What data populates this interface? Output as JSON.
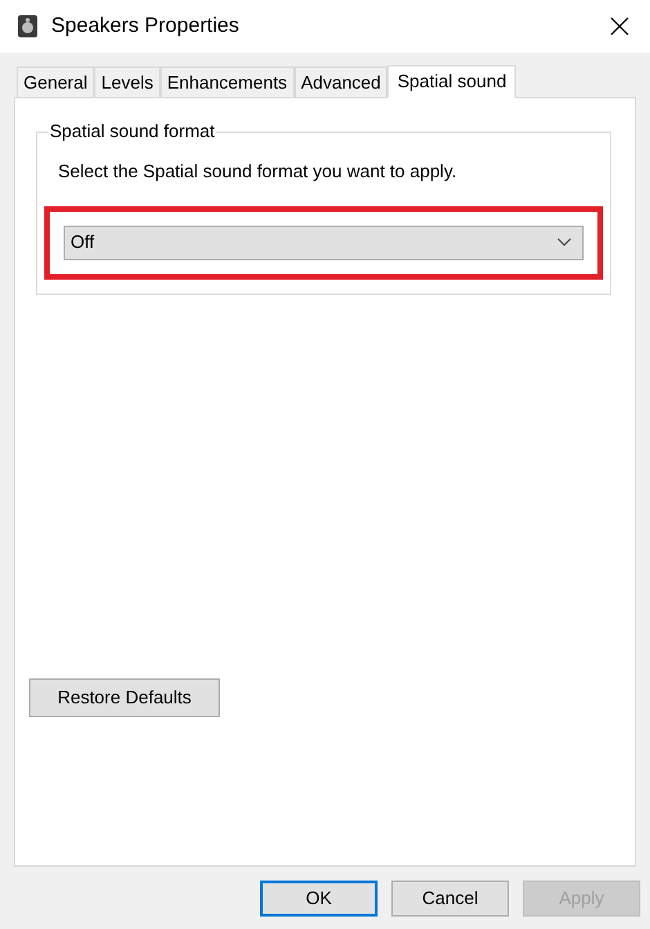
{
  "window": {
    "title": "Speakers Properties"
  },
  "tabs": [
    {
      "label": "General",
      "selected": false
    },
    {
      "label": "Levels",
      "selected": false
    },
    {
      "label": "Enhancements",
      "selected": false
    },
    {
      "label": "Advanced",
      "selected": false
    },
    {
      "label": "Spatial sound",
      "selected": true
    }
  ],
  "group": {
    "title": "Spatial sound format",
    "description": "Select the Spatial sound format you want to apply.",
    "dropdown": {
      "value": "Off",
      "highlighted": true
    }
  },
  "restore_button": "Restore Defaults",
  "buttons": [
    {
      "label": "OK",
      "default": true,
      "disabled": false
    },
    {
      "label": "Cancel",
      "default": false,
      "disabled": false
    },
    {
      "label": "Apply",
      "default": false,
      "disabled": true
    }
  ]
}
